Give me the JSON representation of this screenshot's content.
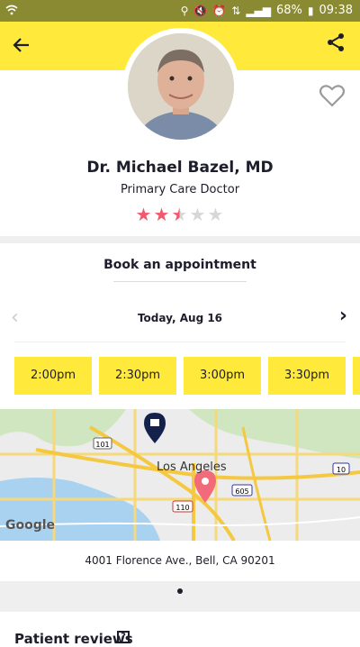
{
  "status_bar": {
    "battery": "68%",
    "time": "09:38"
  },
  "header": {
    "back_icon": "back-arrow-icon",
    "share_icon": "share-icon"
  },
  "doctor": {
    "name": "Dr. Michael Bazel, MD",
    "specialty": "Primary Care Doctor",
    "rating": 2.5,
    "rating_max": 5,
    "favorite_icon": "heart-outline-icon"
  },
  "booking": {
    "title": "Book an appointment",
    "date_label": "Today, Aug 16",
    "slots": [
      "2:00pm",
      "2:30pm",
      "3:00pm",
      "3:30pm"
    ]
  },
  "map": {
    "city_label": "Los Angeles",
    "highway_labels": [
      "101",
      "110",
      "605",
      "10"
    ],
    "brand": "Google",
    "marker_colors": {
      "office": "#14214a",
      "location": "#f26b7a"
    }
  },
  "address": "4001 Florence Ave., Bell, CA 90201",
  "reviews": {
    "title": "Patient reviews"
  },
  "colors": {
    "accent": "#ffea3c",
    "star_filled": "#f2576d",
    "star_empty": "#d7d7d7"
  }
}
